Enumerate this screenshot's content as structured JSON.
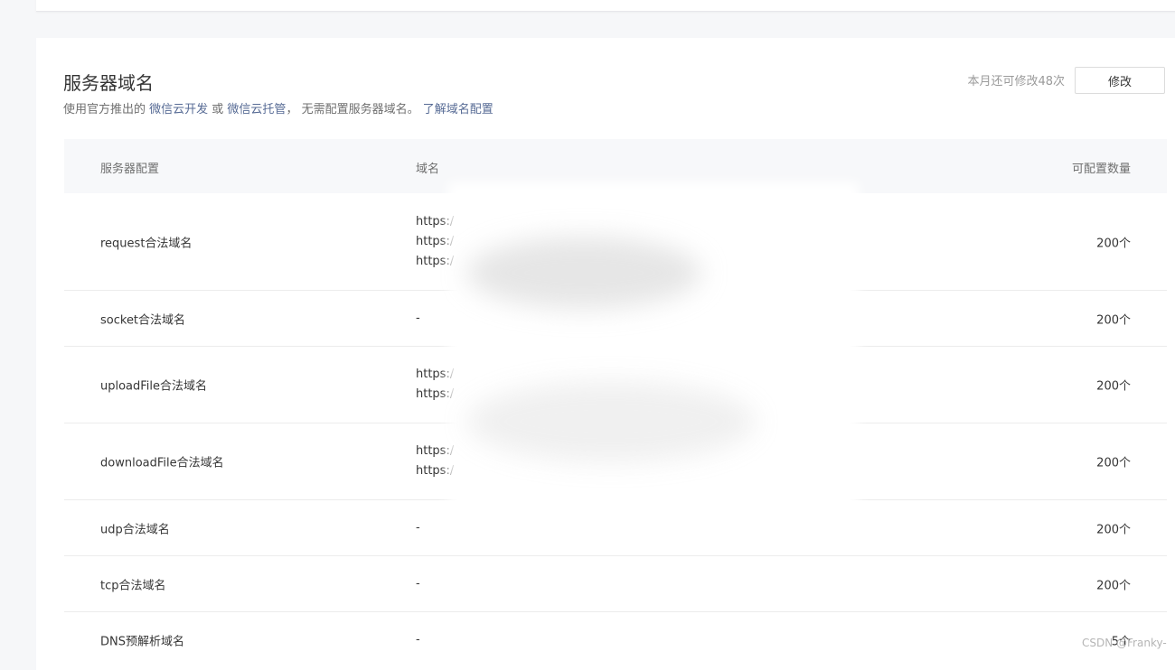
{
  "section": {
    "title": "服务器域名",
    "desc_prefix": "使用官方推出的 ",
    "link_cloud_dev": "微信云开发",
    "desc_or": " 或 ",
    "link_cloud_host": "微信云托管",
    "desc_suffix": "， 无需配置服务器域名。 ",
    "link_learn": "了解域名配置",
    "quota_text": "本月还可修改48次",
    "edit_button": "修改"
  },
  "table": {
    "headers": [
      "服务器配置",
      "域名",
      "可配置数量"
    ],
    "rows": [
      {
        "label": "request合法域名",
        "domains": [
          "https:/",
          "https:/",
          "https:/"
        ],
        "count": "200个"
      },
      {
        "label": "socket合法域名",
        "domains": [
          "-"
        ],
        "count": "200个"
      },
      {
        "label": "uploadFile合法域名",
        "domains": [
          "https:/",
          "https:/"
        ],
        "count": "200个"
      },
      {
        "label": "downloadFile合法域名",
        "domains": [
          "https:/",
          "https:/"
        ],
        "count": "200个"
      },
      {
        "label": "udp合法域名",
        "domains": [
          "-"
        ],
        "count": "200个"
      },
      {
        "label": "tcp合法域名",
        "domains": [
          "-"
        ],
        "count": "200个"
      },
      {
        "label": "DNS预解析域名",
        "domains": [
          "-"
        ],
        "count": "5个"
      }
    ]
  },
  "watermark": "CSDN @Franky-",
  "colors": {
    "link": "#576b95",
    "header_bg": "#f7f8fa",
    "page_bg": "#f6f7f9"
  }
}
